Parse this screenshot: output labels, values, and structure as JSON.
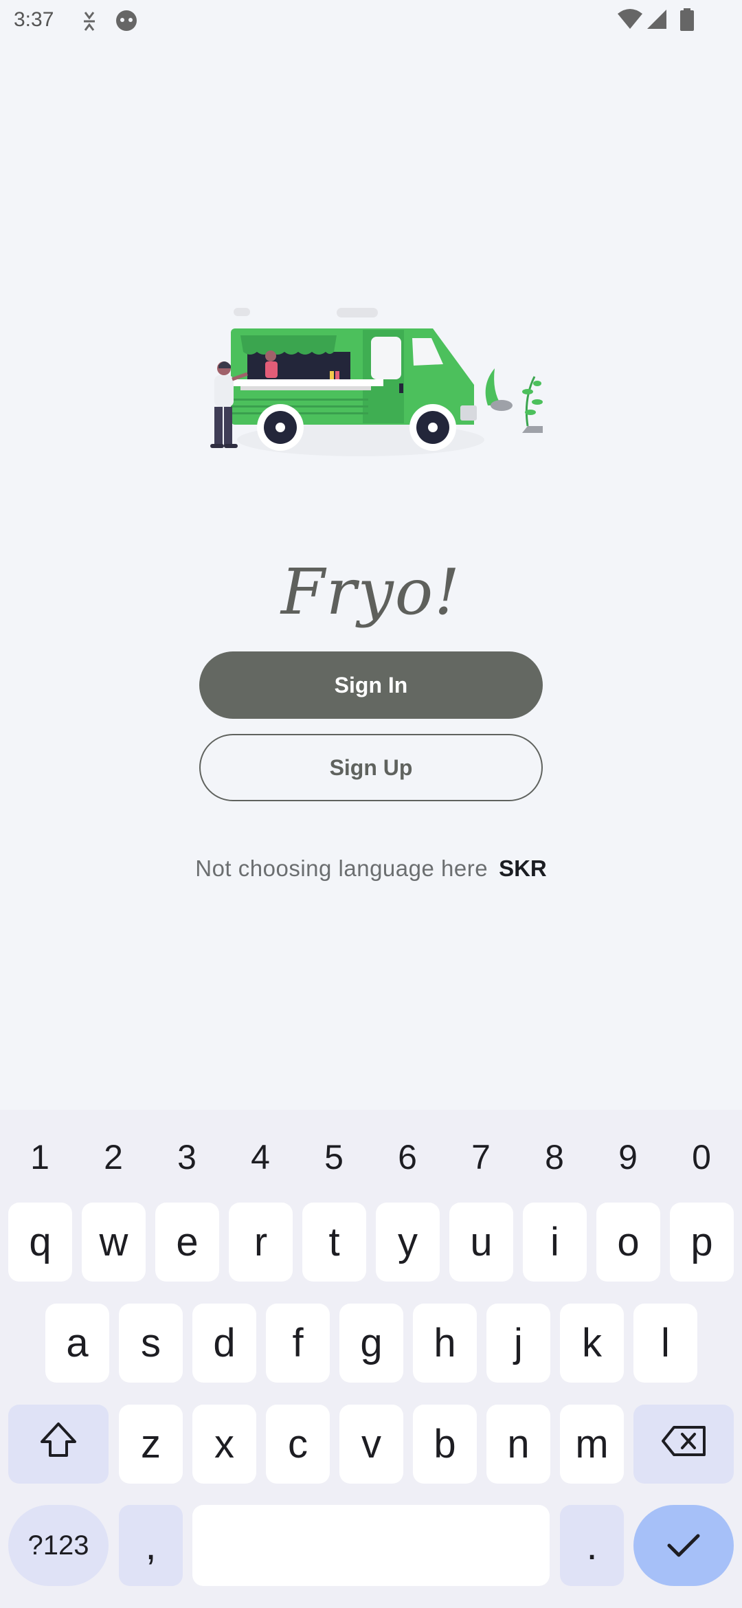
{
  "status_bar": {
    "time": "3:37",
    "icons_left": [
      "usb-debug-icon",
      "android-face-icon"
    ],
    "icons_right": [
      "wifi-icon",
      "cell-signal-icon",
      "battery-icon"
    ]
  },
  "hero": {
    "illustration": "food-truck-illustration"
  },
  "app": {
    "logo": "Fryo!"
  },
  "buttons": {
    "sign_in": "Sign In",
    "sign_up": "Sign Up"
  },
  "language": {
    "text": "Not choosing language here",
    "code": "SKR"
  },
  "keyboard": {
    "numbers": [
      "1",
      "2",
      "3",
      "4",
      "5",
      "6",
      "7",
      "8",
      "9",
      "0"
    ],
    "row1": [
      "q",
      "w",
      "e",
      "r",
      "t",
      "y",
      "u",
      "i",
      "o",
      "p"
    ],
    "row2": [
      "a",
      "s",
      "d",
      "f",
      "g",
      "h",
      "j",
      "k",
      "l"
    ],
    "row3": [
      "z",
      "x",
      "c",
      "v",
      "b",
      "n",
      "m"
    ],
    "symbols_key": "?123",
    "comma": ",",
    "period": ".",
    "colors": {
      "background": "#efeff6",
      "key": "#ffffff",
      "function_key": "#dfe2f6",
      "enter_key": "#a6c0f8"
    }
  },
  "colors": {
    "page_background": "#f3f5f9",
    "primary_button": "#646862",
    "truck_green": "#4cc05c",
    "text_muted": "#6b6e70"
  }
}
